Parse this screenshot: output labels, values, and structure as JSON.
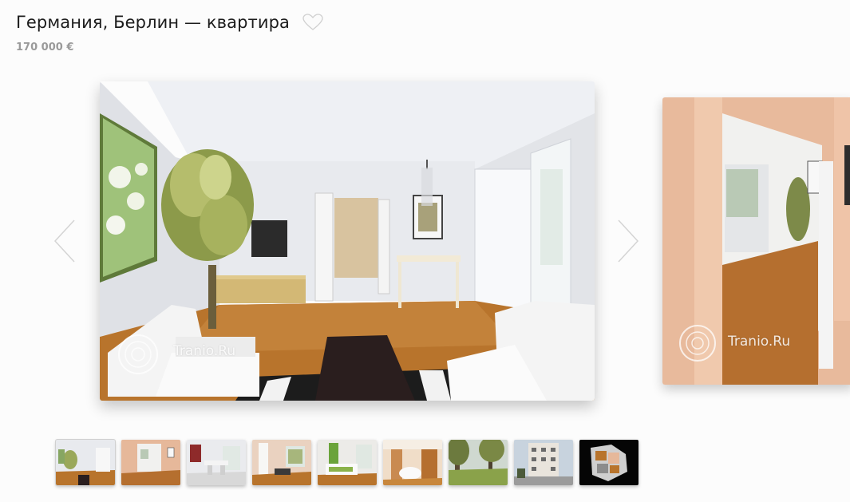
{
  "header": {
    "title": "Германия, Берлин — квартира",
    "price": "170 000 €"
  },
  "gallery": {
    "watermark_text": "Tranio.Ru",
    "thumbnails": [
      {
        "name": "thumb-living-room",
        "active": true
      },
      {
        "name": "thumb-hallway"
      },
      {
        "name": "thumb-dining"
      },
      {
        "name": "thumb-room-window"
      },
      {
        "name": "thumb-bedroom"
      },
      {
        "name": "thumb-kitchen"
      },
      {
        "name": "thumb-park"
      },
      {
        "name": "thumb-building"
      },
      {
        "name": "thumb-floor-plan"
      }
    ]
  },
  "colors": {
    "accent_floor": "#b8742c",
    "wall": "#e9eaee",
    "peach_wall": "#e6b99b"
  }
}
